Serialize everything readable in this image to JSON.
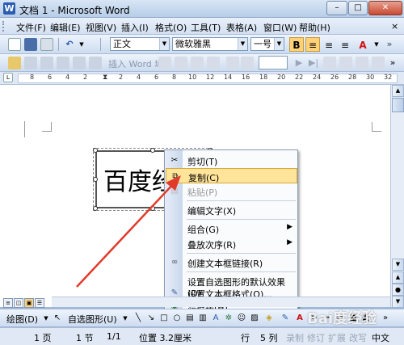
{
  "window": {
    "title": "文档 1 - Microsoft Word",
    "minimize": "–",
    "maximize": "□",
    "close": "✕"
  },
  "menubar": {
    "items": [
      "文件(F)",
      "编辑(E)",
      "视图(V)",
      "插入(I)",
      "格式(O)",
      "工具(T)",
      "表格(A)",
      "窗口(W)",
      "帮助(H)"
    ],
    "close_doc": "×"
  },
  "formatting": {
    "style": "正文",
    "font": "微软雅黑",
    "size": "一号",
    "bold": "B",
    "font_color_letter": "A"
  },
  "toolbar2": {
    "insert_word": "插入 Word 域"
  },
  "document": {
    "textbox_text": "百度经验"
  },
  "context_menu": {
    "items": [
      {
        "label": "剪切(T)",
        "icon": "cut-icon",
        "state": "normal"
      },
      {
        "label": "复制(C)",
        "icon": "copy-icon",
        "state": "highlighted"
      },
      {
        "label": "粘贴(P)",
        "icon": "paste-icon",
        "state": "disabled"
      },
      {
        "label": "编辑文字(X)",
        "icon": "",
        "state": "normal"
      },
      {
        "label": "组合(G)",
        "icon": "",
        "state": "submenu"
      },
      {
        "label": "叠放次序(R)",
        "icon": "",
        "state": "submenu"
      },
      {
        "label": "创建文本框链接(R)",
        "icon": "link-icon",
        "state": "normal"
      },
      {
        "label": "设置自选图形的默认效果(D)",
        "icon": "",
        "state": "normal"
      },
      {
        "label": "设置文本框格式(O)...",
        "icon": "format-icon",
        "state": "normal"
      },
      {
        "label": "超链接(H)...",
        "icon": "hyperlink-icon",
        "state": "normal"
      }
    ]
  },
  "drawing_toolbar": {
    "draw": "绘图(D)",
    "autoshapes": "自选图形(U)"
  },
  "statusbar": {
    "page": "1 页",
    "section": "1 节",
    "page_of": "1/1",
    "position": "位置 3.2厘米",
    "line": "行",
    "column": "5 列",
    "rec": "录制",
    "trk": "修订",
    "ext": "扩展",
    "ovr": "改写",
    "lang": "中文"
  },
  "watermark": "Bai度经验"
}
